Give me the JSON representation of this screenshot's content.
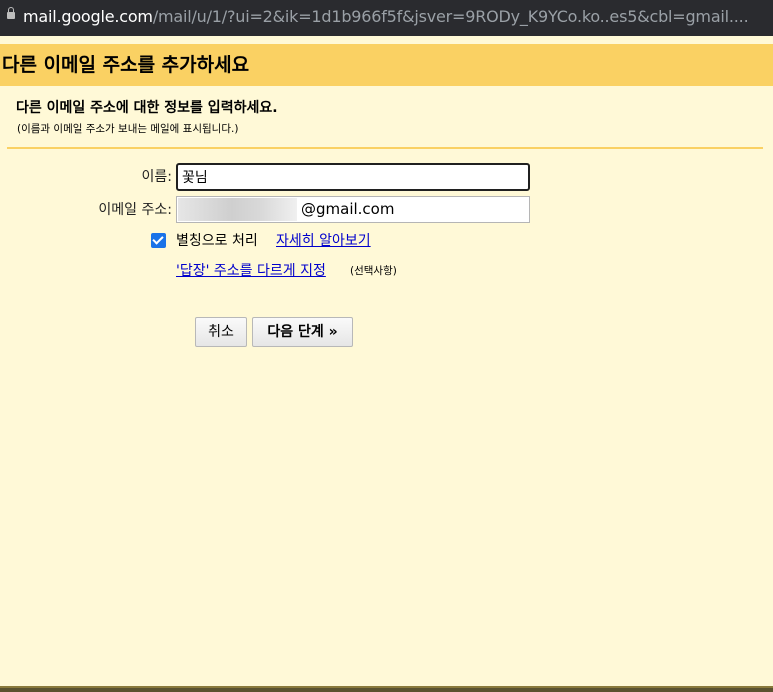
{
  "browser": {
    "url_host": "mail.google.com",
    "url_path": "/mail/u/1/?ui=2&ik=1d1b966f5f&jsver=9RODy_K9YCo.ko..es5&cbl=gmail...."
  },
  "header": {
    "title": "다른 이메일 주소를 추가하세요"
  },
  "intro": {
    "title": "다른 이메일 주소에 대한 정보를 입력하세요.",
    "subtitle": "(이름과 이메일 주소가 보내는 메일에 표시됩니다.)"
  },
  "form": {
    "name_label": "이름:",
    "name_value": "꽃님",
    "email_label": "이메일 주소:",
    "email_domain": "@gmail.com",
    "alias_checked": true,
    "alias_label": "별칭으로 처리",
    "learn_more": "자세히 알아보기",
    "reply_to_link": "'답장' 주소를 다르게 지정",
    "optional": "(선택사항)"
  },
  "buttons": {
    "cancel": "취소",
    "next": "다음 단계 »"
  },
  "colors": {
    "header_bg": "#fad163",
    "page_bg": "#fff9d7",
    "link": "#0000cc",
    "checkbox": "#1a73e8"
  }
}
